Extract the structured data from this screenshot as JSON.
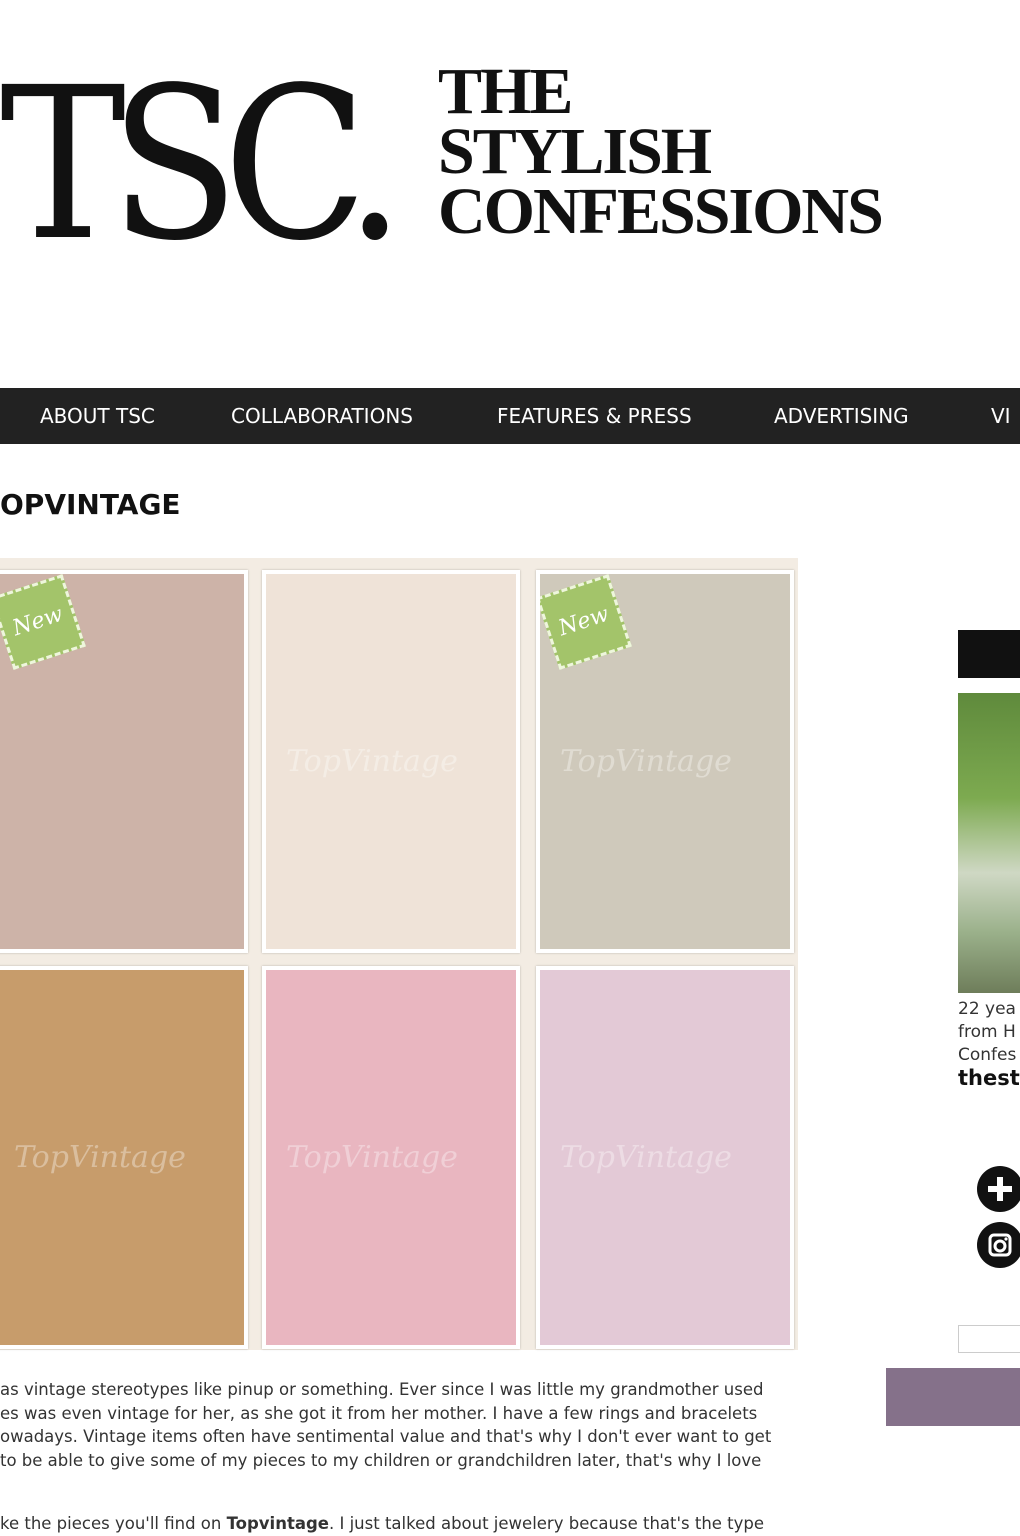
{
  "header": {
    "logo_mark": "TSC.",
    "logo_words": [
      "THE",
      "STYLISH",
      "CONFESSIONS"
    ]
  },
  "nav": {
    "items": [
      "ABOUT TSC",
      "COLLABORATIONS",
      "FEATURES & PRESS",
      "ADVERTISING",
      "VI"
    ]
  },
  "post": {
    "title": "OPVINTAGE",
    "tiles": [
      {
        "name": "pearl-necklace",
        "new": true,
        "badge": "New",
        "watermark": "",
        "color": "#cdb3a8"
      },
      {
        "name": "pearl-earrings",
        "new": false,
        "badge": "",
        "watermark": "TopVintage",
        "color": "#efe3d8"
      },
      {
        "name": "floral-bag",
        "new": true,
        "badge": "New",
        "watermark": "TopVintage",
        "color": "#cfc9bb"
      },
      {
        "name": "navy-satchel",
        "new": false,
        "badge": "",
        "watermark": "TopVintage",
        "color": "#c79c6b"
      },
      {
        "name": "leopard-handbag",
        "new": false,
        "badge": "",
        "watermark": "TopVintage",
        "color": "#e9b6c0"
      },
      {
        "name": "heart-locket",
        "new": false,
        "badge": "",
        "watermark": "TopVintage",
        "color": "#e3c9d6"
      }
    ],
    "paragraph_lines": [
      " as vintage stereotypes like pinup or something. Ever since I was little my grandmother used",
      "es was even vintage for her, as she got it from her mother. I have a few rings and bracelets",
      "owadays. Vintage items often have sentimental value and that's why I don't ever want to get",
      " to be able to give some of my pieces to my children or grandchildren later, that's why I love"
    ],
    "paragraph2": "ke the pieces you'll find on Topvintage. I just talked about jewelery because that's the type"
  },
  "sidebar": {
    "caption_lines": [
      "22 yea",
      "from H",
      "Confes"
    ],
    "handle": "thest",
    "icons": [
      "plus-icon",
      "instagram-icon"
    ]
  }
}
